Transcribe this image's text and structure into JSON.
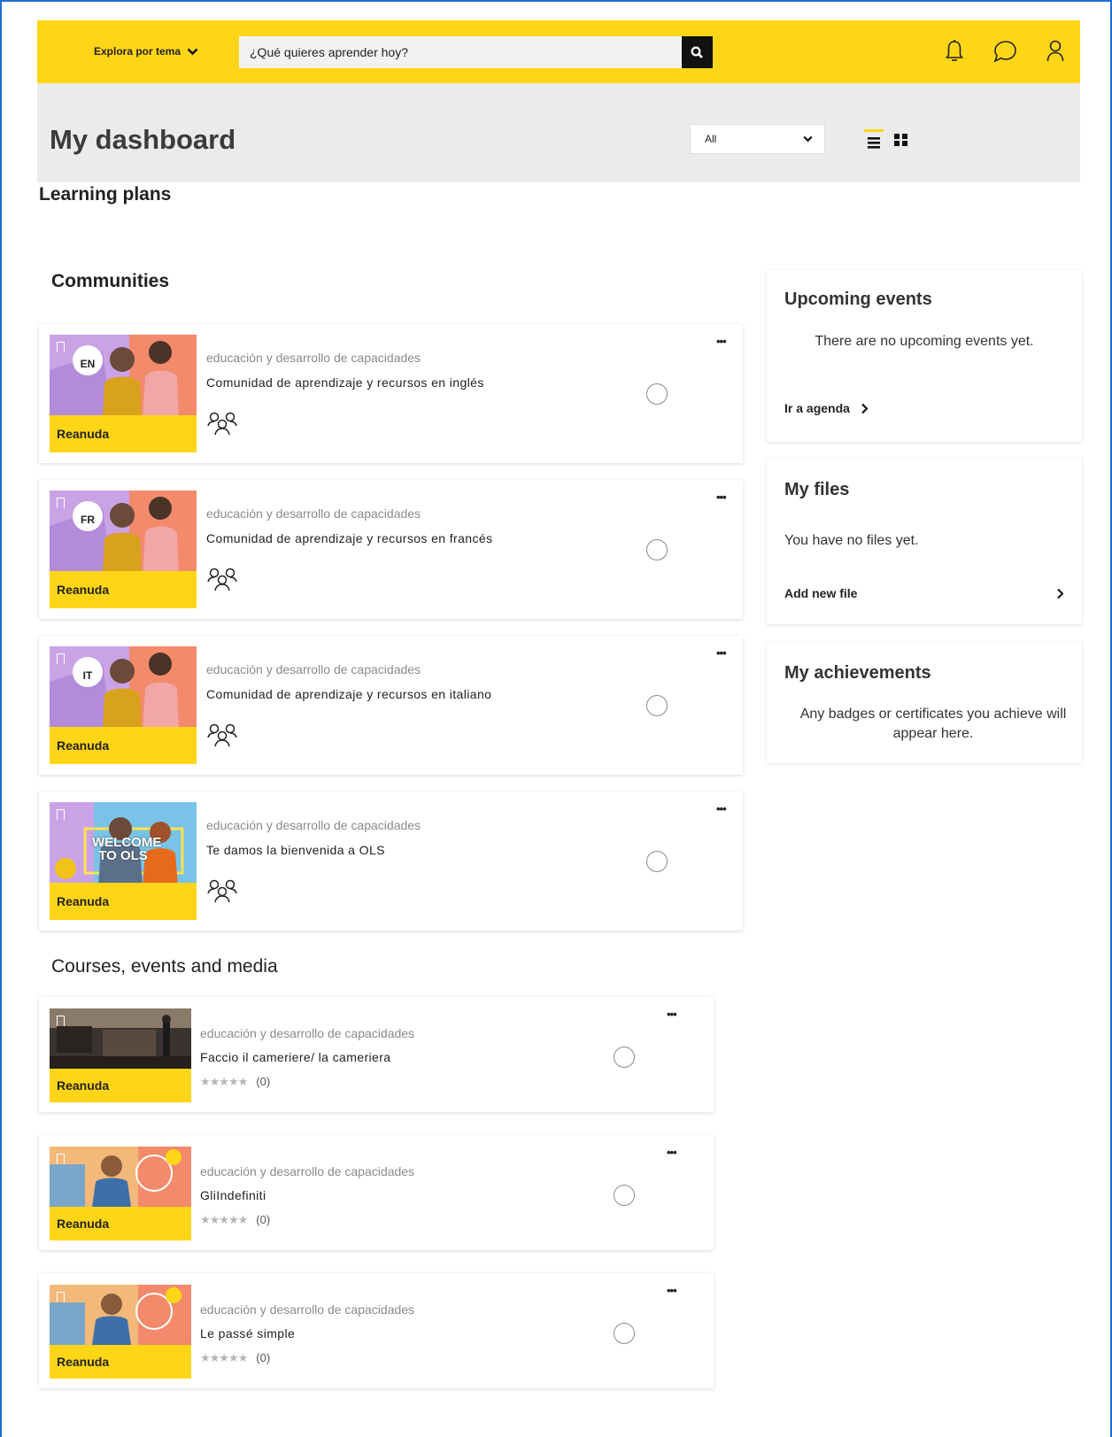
{
  "header": {
    "explore_label": "Explora por tema",
    "search_placeholder": "¿Qué quieres aprender hoy?"
  },
  "dashboard": {
    "title": "My dashboard",
    "filter_value": "All"
  },
  "sections": {
    "learning_plans": "Learning plans",
    "communities": "Communities",
    "courses": "Courses, events and media"
  },
  "communities": [
    {
      "lang": "EN",
      "category": "educación y desarrollo de capacidades",
      "title": "Comunidad de aprendizaje y recursos en inglés",
      "action": "Reanuda"
    },
    {
      "lang": "FR",
      "category": "educación y desarrollo de capacidades",
      "title": "Comunidad de aprendizaje y recursos en francés",
      "action": "Reanuda"
    },
    {
      "lang": "IT",
      "category": "educación y desarrollo de capacidades",
      "title": "Comunidad de aprendizaje y recursos en italiano",
      "action": "Reanuda"
    },
    {
      "lang": "",
      "thumb_text": "WELCOME TO OLS",
      "category": "educación y desarrollo de capacidades",
      "title": "Te damos la bienvenida a OLS",
      "action": "Reanuda"
    }
  ],
  "courses": [
    {
      "category": "educación y desarrollo de capacidades",
      "title": "Faccio il cameriere/ la cameriera",
      "rating_count": "(0)",
      "action": "Reanuda"
    },
    {
      "category": "educación y desarrollo de capacidades",
      "title": "GliIndefiniti",
      "rating_count": "(0)",
      "action": "Reanuda"
    },
    {
      "category": "educación y desarrollo de capacidades",
      "title": "Le passé simple",
      "rating_count": "(0)",
      "action": "Reanuda"
    }
  ],
  "sidebar": {
    "upcoming": {
      "title": "Upcoming events",
      "empty_text": "There are no upcoming events yet.",
      "link": "Ir a agenda"
    },
    "files": {
      "title": "My files",
      "empty_text": "You have no files yet.",
      "link": "Add new file"
    },
    "achievements": {
      "title": "My achievements",
      "empty_text": "Any badges or certificates you achieve will appear here."
    }
  },
  "colors": {
    "accent": "#ffd617",
    "frame": "#1f6fd1",
    "header_bg": "#ebebeb"
  },
  "icons": [
    "chevron-down-icon",
    "search-icon",
    "bell-icon",
    "chat-icon",
    "user-icon",
    "list-view-icon",
    "grid-view-icon",
    "bookmark-icon",
    "community-people-icon",
    "more-icon",
    "chevron-right-icon"
  ]
}
